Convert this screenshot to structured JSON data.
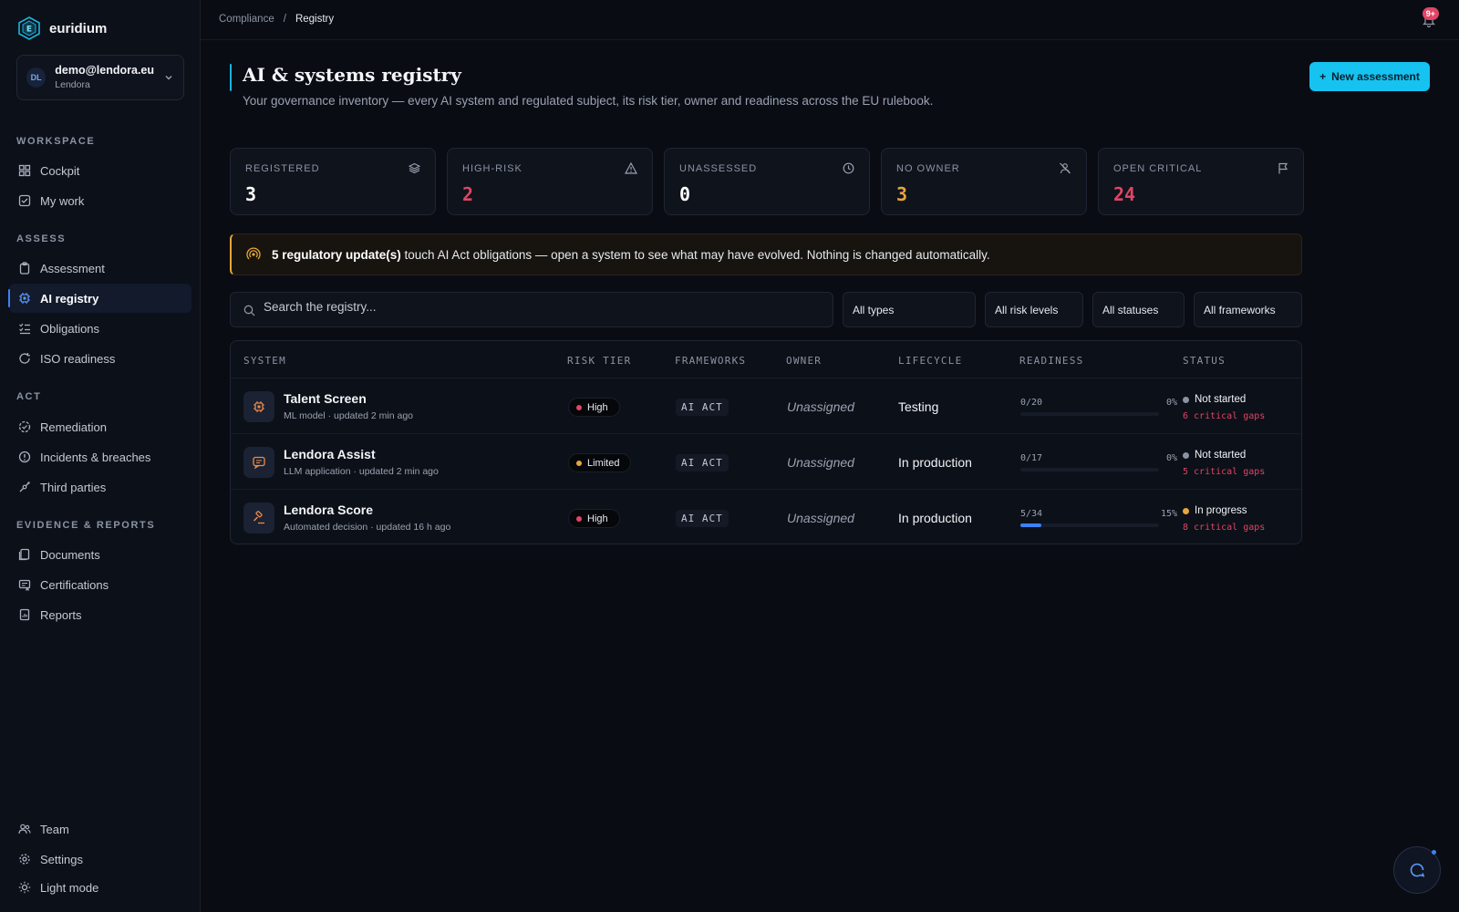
{
  "brand": {
    "name": "euridium"
  },
  "account": {
    "initials": "DL",
    "email": "demo@lendora.eu",
    "org": "Lendora"
  },
  "sidebar": {
    "sections": {
      "workspace": "WORKSPACE",
      "assess": "ASSESS",
      "act": "ACT",
      "evidence": "EVIDENCE & REPORTS"
    },
    "items": {
      "cockpit": "Cockpit",
      "my_work": "My work",
      "assessment": "Assessment",
      "ai_registry": "AI registry",
      "obligations": "Obligations",
      "iso_readiness": "ISO readiness",
      "remediation": "Remediation",
      "incidents": "Incidents & breaches",
      "third_parties": "Third parties",
      "documents": "Documents",
      "certifications": "Certifications",
      "reports": "Reports",
      "team": "Team",
      "settings": "Settings",
      "light_mode": "Light mode"
    },
    "active": "ai_registry"
  },
  "topbar": {
    "breadcrumb": [
      "Compliance",
      "Registry"
    ],
    "separator": "/",
    "notifications_badge": "9+"
  },
  "header": {
    "title": "AI & systems registry",
    "subtitle": "Your governance inventory — every AI system and regulated subject, its risk tier, owner and readiness across the EU rulebook.",
    "new_button": "New assessment",
    "new_button_icon": "+"
  },
  "stats": [
    {
      "label": "REGISTERED",
      "value": "3",
      "icon": "layers-icon",
      "color": "#ffffff"
    },
    {
      "label": "HIGH-RISK",
      "value": "2",
      "icon": "warning-icon",
      "color": "#e04565"
    },
    {
      "label": "UNASSESSED",
      "value": "0",
      "icon": "clock-icon",
      "color": "#ffffff"
    },
    {
      "label": "NO OWNER",
      "value": "3",
      "icon": "user-off-icon",
      "color": "#e8a53a"
    },
    {
      "label": "OPEN CRITICAL",
      "value": "24",
      "icon": "flag-icon",
      "color": "#e04565"
    }
  ],
  "banner": {
    "bold": "5 regulatory update(s)",
    "text": " touch AI Act obligations — open a system to see what may have evolved. Nothing is changed automatically."
  },
  "search": {
    "placeholder": "Search the registry..."
  },
  "filters": [
    "All types",
    "All risk levels",
    "All statuses",
    "All frameworks"
  ],
  "table": {
    "columns": [
      "SYSTEM",
      "RISK TIER",
      "FRAMEWORKS",
      "OWNER",
      "LIFECYCLE",
      "READINESS",
      "STATUS"
    ],
    "rows": [
      {
        "name": "Talent Screen",
        "meta": "ML model · updated 2 min ago",
        "icon": "chip-icon",
        "risk": "High",
        "risk_color": "#e04565",
        "framework": "AI ACT",
        "owner": "Unassigned",
        "lifecycle": "Testing",
        "ready_frac": "0/20",
        "ready_pct": "0%",
        "ready_value": 0,
        "status": "Not started",
        "status_color": "#8b93a3",
        "gaps": "6 critical gaps"
      },
      {
        "name": "Lendora Assist",
        "meta": "LLM application · updated 2 min ago",
        "icon": "chat-icon",
        "risk": "Limited",
        "risk_color": "#e8a53a",
        "framework": "AI ACT",
        "owner": "Unassigned",
        "lifecycle": "In production",
        "ready_frac": "0/17",
        "ready_pct": "0%",
        "ready_value": 0,
        "status": "Not started",
        "status_color": "#8b93a3",
        "gaps": "5 critical gaps"
      },
      {
        "name": "Lendora Score",
        "meta": "Automated decision · updated 16 h ago",
        "icon": "gavel-icon",
        "risk": "High",
        "risk_color": "#e04565",
        "framework": "AI ACT",
        "owner": "Unassigned",
        "lifecycle": "In production",
        "ready_frac": "5/34",
        "ready_pct": "15%",
        "ready_value": 0.15,
        "status": "In progress",
        "status_color": "#e8a53a",
        "gaps": "8 critical gaps"
      }
    ]
  }
}
